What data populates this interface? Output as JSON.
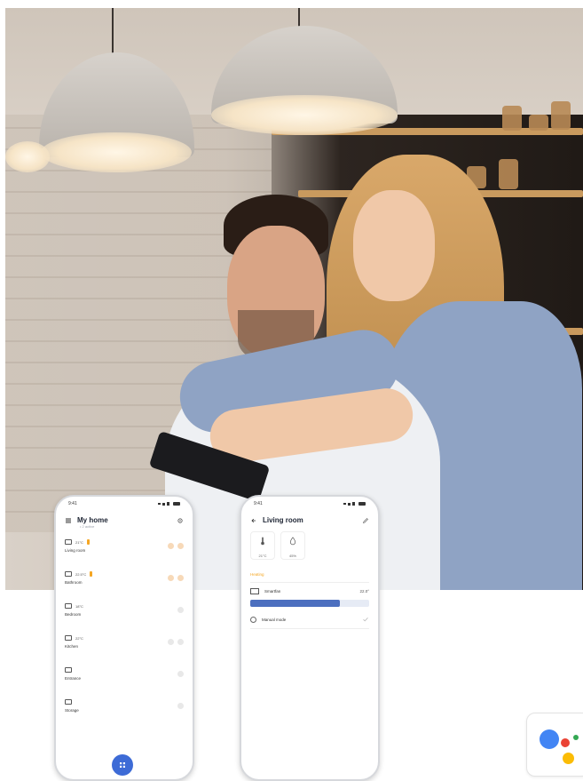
{
  "phone_home": {
    "time": "9:41",
    "title": "My home",
    "subtitle": "• 2 active",
    "rooms": [
      {
        "temp": "21°C",
        "name": "Living room",
        "icon": "sofa-icon",
        "active": true
      },
      {
        "temp": "22.5°C",
        "name": "Bathroom",
        "icon": "bathtub-icon",
        "active": true
      },
      {
        "temp": "18°C",
        "name": "Bedroom",
        "icon": "bed-icon",
        "active": false
      },
      {
        "temp": "22°C",
        "name": "Kitchen",
        "icon": "pot-icon",
        "active": false
      },
      {
        "temp": "",
        "name": "Entrance",
        "icon": "door-icon",
        "active": false
      },
      {
        "temp": "",
        "name": "Storage",
        "icon": "box-icon",
        "active": false
      }
    ],
    "fab_icon": "grid-icon"
  },
  "phone_room": {
    "time": "9:41",
    "title": "Living room",
    "tiles": [
      {
        "icon": "thermometer-icon",
        "value": "21°C"
      },
      {
        "icon": "droplet-icon",
        "value": "45%"
      }
    ],
    "section": "Heating",
    "device": {
      "name": "Smartfan",
      "value": "22.0°"
    },
    "slider_level": 0.75,
    "schedule_label": "Manual mode"
  },
  "colors": {
    "accent_blue": "#3d6bd6",
    "slider_fill": "#4c6fbf",
    "warning_orange": "#f5a623"
  },
  "badge": {
    "icon": "google-assistant-icon"
  }
}
